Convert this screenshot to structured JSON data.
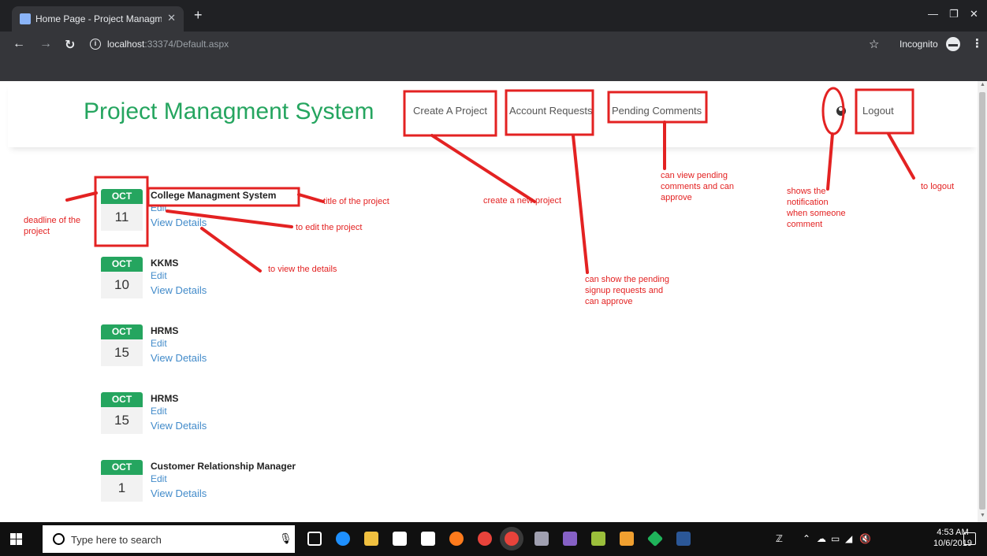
{
  "browser": {
    "tab_title": "Home Page - Project Managmen",
    "tab_close": "✕",
    "new_tab": "+",
    "url_host": "localhost",
    "url_path": ":33374/Default.aspx",
    "incognito_label": "Incognito"
  },
  "site": {
    "brand": "Project Managment System",
    "nav": {
      "create_project": "Create A Project",
      "account_requests": "Account Requests",
      "pending_comments": "Pending Comments",
      "logout": "Logout"
    }
  },
  "projects": [
    {
      "month": "OCT",
      "day": "11",
      "title": "College Managment System",
      "edit": "Edit",
      "view": "View Details"
    },
    {
      "month": "OCT",
      "day": "10",
      "title": "KKMS",
      "edit": "Edit",
      "view": "View Details"
    },
    {
      "month": "OCT",
      "day": "15",
      "title": "HRMS",
      "edit": "Edit",
      "view": "View Details"
    },
    {
      "month": "OCT",
      "day": "15",
      "title": "HRMS",
      "edit": "Edit",
      "view": "View Details"
    },
    {
      "month": "OCT",
      "day": "1",
      "title": "Customer Relationship Manager",
      "edit": "Edit",
      "view": "View Details"
    }
  ],
  "annotations": {
    "deadline": [
      "deadline of the",
      "project"
    ],
    "title_note": "title of the project",
    "edit_note": "to edit the project",
    "view_note": "to view the details",
    "create_note": "create a new project",
    "account_note": [
      "can show the pending",
      "signup requests and",
      "can approve"
    ],
    "comments_note": [
      "can view pending",
      "comments and can",
      "approve"
    ],
    "notify_note": [
      "shows the",
      "notification",
      "when someone",
      "comment"
    ],
    "logout_note": "to logout",
    "color": "#e32222"
  },
  "taskbar": {
    "search_placeholder": "Type here to search",
    "time": "4:53 AM",
    "date": "10/6/2019"
  }
}
